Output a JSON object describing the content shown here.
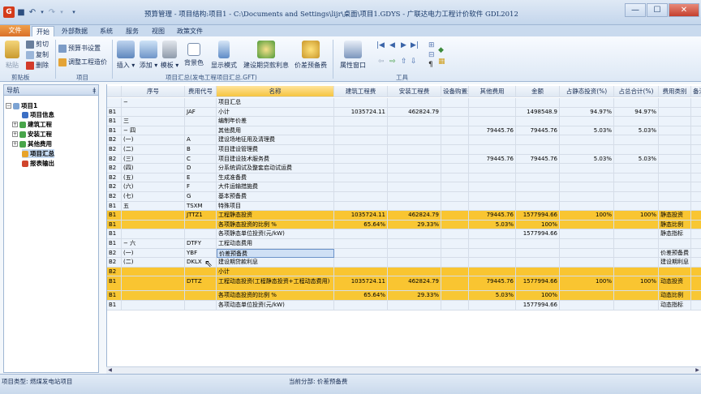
{
  "window": {
    "title": "预算管理 - 项目结构:项目1 - C:\\Documents and Settings\\lijr\\桌面\\项目1.GDYS - 广联达电力工程计价软件 GDL2012",
    "minimize": "—",
    "maximize": "☐",
    "close": "✕"
  },
  "tabs": [
    "文件",
    "开始",
    "外部数据",
    "系统",
    "服务",
    "视图",
    "政策文件"
  ],
  "ribbon": {
    "clipboard": {
      "paste": "粘贴",
      "cut": "剪切",
      "copy": "复制",
      "delete": "删除",
      "group": "剪贴板"
    },
    "project": {
      "budget_setting": "预算书设置",
      "adjust_price": "调整工程造价",
      "group": "项目"
    },
    "insert": "插入",
    "add": "添加",
    "template": "模板",
    "bgcolor": "背景色",
    "display_mode": "显示模式",
    "loan_interest": "建设期贷款利息",
    "price_reserve": "价差预备费",
    "property_window": "属性窗口",
    "summary_group": "项目汇总(发电工程项目汇总.GFT)",
    "tools_group": "工具"
  },
  "nav": {
    "title": "导航",
    "pin": "ǂ",
    "items": [
      {
        "label": "项目1",
        "expander": "−"
      },
      {
        "label": "项目信息",
        "expander": ""
      },
      {
        "label": "建筑工程",
        "expander": "+"
      },
      {
        "label": "安装工程",
        "expander": "+"
      },
      {
        "label": "其他费用",
        "expander": "+"
      },
      {
        "label": "项目汇总",
        "expander": ""
      },
      {
        "label": "报表输出",
        "expander": ""
      }
    ]
  },
  "grid": {
    "headers": [
      "",
      "序号",
      "费用代号",
      "名称",
      "建筑工程费",
      "安装工程费",
      "设备购置费",
      "其他费用",
      "金额",
      "占静态投资(%)",
      "占总合计(%)",
      "费用类别",
      "备注"
    ],
    "rows": [
      [
        "",
        "−",
        "",
        "项目汇总",
        "",
        "",
        "",
        "",
        "",
        "",
        "",
        "",
        ""
      ],
      [
        "B1",
        "",
        "JAF",
        "小计",
        "1035724.11",
        "462824.79",
        "",
        "",
        "1498548.9",
        "94.97%",
        "94.97%",
        "",
        ""
      ],
      [
        "B1",
        "三",
        "",
        "编制年价差",
        "",
        "",
        "",
        "",
        "",
        "",
        "",
        "",
        ""
      ],
      [
        "B1",
        "− 四",
        "",
        "其他费用",
        "",
        "",
        "",
        "79445.76",
        "79445.76",
        "5.03%",
        "5.03%",
        "",
        ""
      ],
      [
        "B2",
        "(一)",
        "A",
        "建设场地征用及清理费",
        "",
        "",
        "",
        "",
        "",
        "",
        "",
        "",
        ""
      ],
      [
        "B2",
        "(二)",
        "B",
        "项目建设管理费",
        "",
        "",
        "",
        "",
        "",
        "",
        "",
        "",
        ""
      ],
      [
        "B2",
        "(三)",
        "C",
        "项目建设技术服务费",
        "",
        "",
        "",
        "79445.76",
        "79445.76",
        "5.03%",
        "5.03%",
        "",
        ""
      ],
      [
        "B2",
        "(四)",
        "D",
        "分系统调试及整套启动试运费",
        "",
        "",
        "",
        "",
        "",
        "",
        "",
        "",
        ""
      ],
      [
        "B2",
        "(五)",
        "E",
        "生成准备费",
        "",
        "",
        "",
        "",
        "",
        "",
        "",
        "",
        ""
      ],
      [
        "B2",
        "(六)",
        "F",
        "大件运输措施费",
        "",
        "",
        "",
        "",
        "",
        "",
        "",
        "",
        ""
      ],
      [
        "B2",
        "(七)",
        "G",
        "基本预备费",
        "",
        "",
        "",
        "",
        "",
        "",
        "",
        "",
        ""
      ],
      [
        "B1",
        "五",
        "TSXM",
        "特殊项目",
        "",
        "",
        "",
        "",
        "",
        "",
        "",
        "",
        ""
      ],
      [
        "B1",
        "",
        "JTTZ1",
        "工程静态投资",
        "1035724.11",
        "462824.79",
        "",
        "79445.76",
        "1577994.66",
        "100%",
        "100%",
        "静态投资",
        ""
      ],
      [
        "B1",
        "",
        "",
        "各项静态投资的比例 %",
        "65.64%",
        "29.33%",
        "",
        "5.03%",
        "100%",
        "",
        "",
        "静态比例",
        ""
      ],
      [
        "B1",
        "",
        "",
        "各项静态单位投资(元/kW)",
        "",
        "",
        "",
        "",
        "1577994.66",
        "",
        "",
        "静态指标",
        ""
      ],
      [
        "B1",
        "− 六",
        "DTFY",
        "工程动态费用",
        "",
        "",
        "",
        "",
        "",
        "",
        "",
        "",
        ""
      ],
      [
        "B2",
        "(一)",
        "YBF",
        "价差预备费",
        "",
        "",
        "",
        "",
        "",
        "",
        "",
        "价差预备费",
        ""
      ],
      [
        "B2",
        "(二)",
        "DKLX",
        "建设期贷款利息",
        "",
        "",
        "",
        "",
        "",
        "",
        "",
        "建设期利息",
        ""
      ],
      [
        "B2",
        "",
        "",
        "小计",
        "",
        "",
        "",
        "",
        "",
        "",
        "",
        "",
        ""
      ],
      [
        "B1",
        "",
        "DTTZ",
        "工程动态投资(工程静态投资+工程动态费用)",
        "1035724.11",
        "462824.79",
        "",
        "79445.76",
        "1577994.66",
        "100%",
        "100%",
        "动态投资",
        ""
      ],
      [
        "B1",
        "",
        "",
        "各项动态投资的比例 %",
        "65.64%",
        "29.33%",
        "",
        "5.03%",
        "100%",
        "",
        "",
        "动态比例",
        ""
      ],
      [
        "B1",
        "",
        "",
        "各项动态单位投资(元/kW)",
        "",
        "",
        "",
        "",
        "1577994.66",
        "",
        "",
        "动态指标",
        ""
      ]
    ]
  },
  "status": {
    "left": "项目类型: 燃煤发电站项目",
    "mid": "当前分部: 价差预备费"
  }
}
